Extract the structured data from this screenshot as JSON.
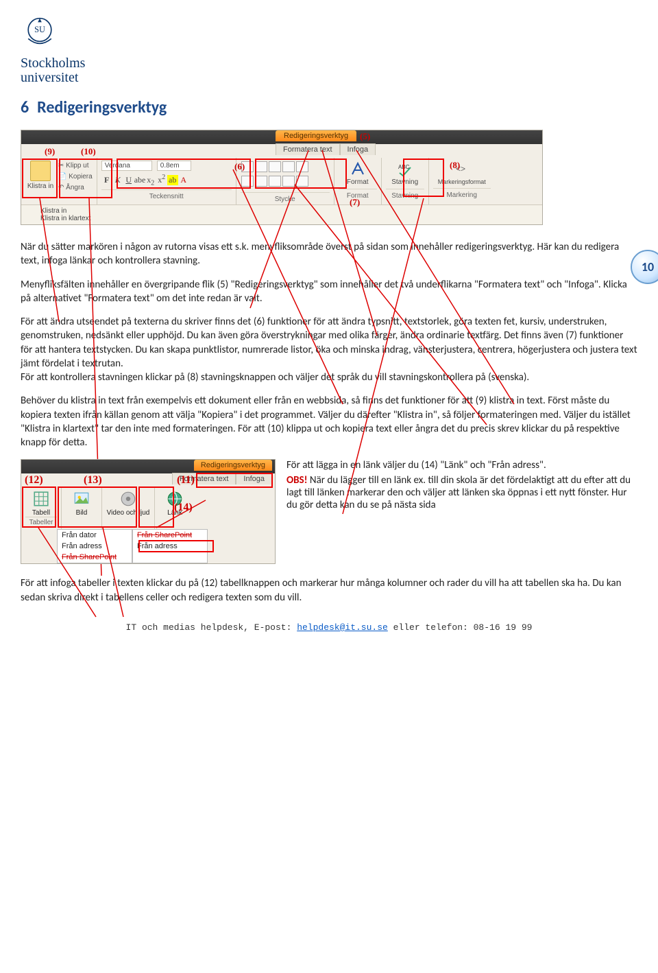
{
  "logo": {
    "line1": "Stockholms",
    "line2": "universitet"
  },
  "section": {
    "num": "6",
    "title": "Redigeringsverktyg"
  },
  "page_badge": "10",
  "ribbon1": {
    "contextual": "Redigeringsverktyg",
    "tabs": [
      "Formatera text",
      "Infoga"
    ],
    "klistra_btn": "Klistra in",
    "klipp_ut": "Klipp ut",
    "kopiera": "Kopiera",
    "angra": "Ångra",
    "klistra_in": "Klistra in",
    "klistra_in_klartext": "Klistra in klartext",
    "font_name": "Verdana",
    "font_size": "0.8em",
    "group_tecken": "Teckensnitt",
    "group_stycke": "Stycke",
    "format_label": "Format",
    "stavning_label": "Stavning",
    "markformat_label": "Markeringsformat",
    "group_format": "Format",
    "group_stavning": "Stavning",
    "group_markering": "Markering",
    "annot_5": "(5)",
    "annot_6": "(6)",
    "annot_7": "(7)",
    "annot_8": "(8)",
    "annot_9": "(9)",
    "annot_10": "(10)"
  },
  "para1": "När du sätter markören i någon av rutorna visas ett s.k. menyfliksområde överst på sidan som innehåller redigeringsverktyg. Här kan du redigera text, infoga länkar och kontrollera stavning.",
  "para2": "Menyfliksfälten innehåller en övergripande flik (5) \"Redigeringsverktyg\" som innehåller det två underflikarna \"Formatera text\" och \"Infoga\". Klicka på alternativet \"Formatera text\" om det inte redan är valt.",
  "para3": "För att ändra utseendet på texterna du skriver finns det (6) funktioner för att ändra typsnitt, textstorlek, göra texten fet, kursiv, understruken, genomstruken, nedsänkt eller upphöjd. Du kan även göra överstrykningar med olika färger, ändra ordinarie textfärg. Det finns även (7) funktioner för att hantera textstycken. Du kan skapa punktlistor, numrerade listor, öka och minska indrag, vänsterjustera, centrera, högerjustera och justera text jämt fördelat i textrutan.\nFör att kontrollera stavningen klickar på (8) stavningsknappen och väljer det språk du vill stavningskontrollera på (svenska).",
  "para4": "Behöver du klistra in text från exempelvis ett dokument eller från en webbsida, så finns det funktioner för att (9) klistra in text. Först måste du kopiera texten ifrån källan genom att välja \"Kopiera\" i det programmet. Väljer du därefter \"Klistra in\", så följer formateringen med. Väljer du istället \"Klistra in klartext\" tar den inte med formateringen. För att (10) klippa ut och kopiera text eller ångra det du precis skrev klickar du på respektive knapp för detta.",
  "ribbon2": {
    "contextual": "Redigeringsverktyg",
    "tabs": [
      "Formatera text",
      "Infoga"
    ],
    "tabell": "Tabell",
    "group_tabeller": "Tabeller",
    "bild": "Bild",
    "video": "Video och ljud",
    "lank": "Länk",
    "fran_dator": "Från dator",
    "fran_adress": "Från adress",
    "fran_sharepoint": "Från SharePoint",
    "annot_11": "(11)",
    "annot_12": "(12)",
    "annot_13": "(13)",
    "annot_14": "(14)"
  },
  "side_para_a": "För att lägga in en länk väljer du (14) \"Länk\" och \"Från adress\".",
  "obs_label": "OBS!",
  "side_para_b": " När du lägger till en länk ex. till din skola är det fördelaktigt att du efter att du lagt till länken markerar den och väljer att länken ska öppnas i ett nytt fönster. Hur du gör detta kan du se på nästa sida",
  "para5": "För att infoga tabeller i texten klickar du på (12) tabellknappen och markerar hur många kolumner och rader du vill ha att tabellen ska ha. Du kan sedan skriva direkt i tabellens celler och redigera texten som du vill.",
  "footer": {
    "prefix": "IT och medias helpdesk, E-post: ",
    "email": "helpdesk@it.su.se",
    "suffix": " eller telefon: 08-16 19 99"
  }
}
